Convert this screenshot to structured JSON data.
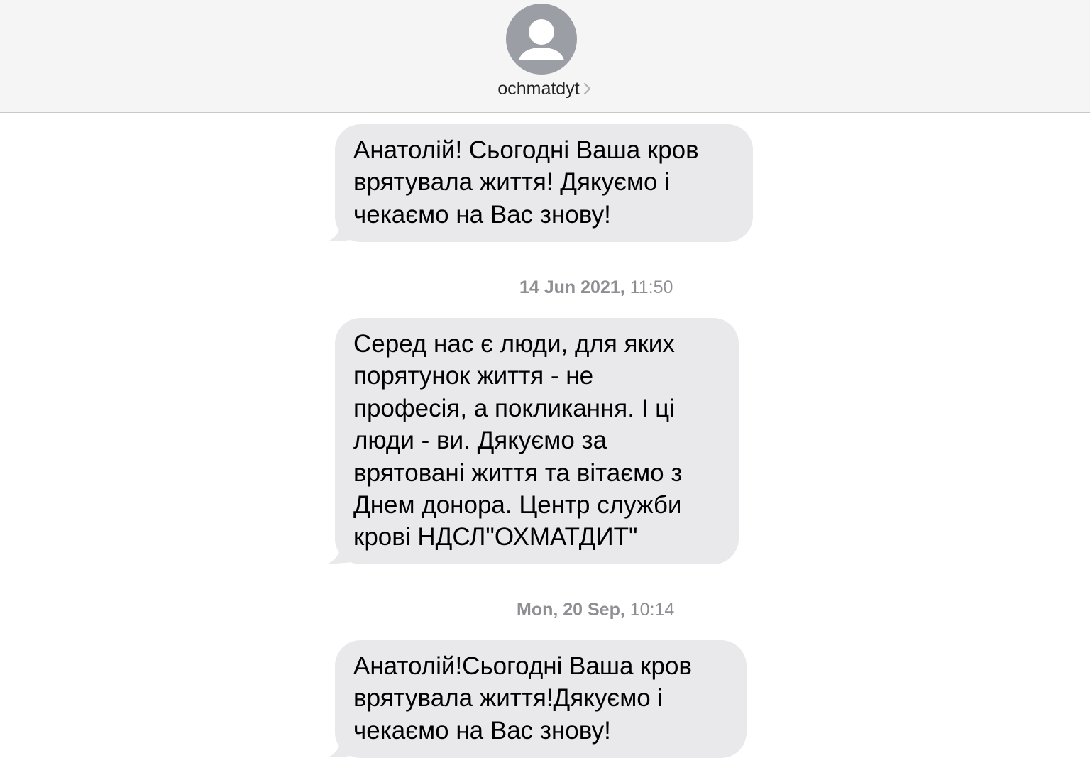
{
  "header": {
    "contact_name": "ochmatdyt",
    "avatar_icon": "person-silhouette-icon",
    "chevron_icon": "chevron-right-icon"
  },
  "colors": {
    "header_bg": "#f5f5f5",
    "incoming_bubble": "#e9e9eb",
    "avatar": "#9c9ea6",
    "timestamp_text": "#8e8e93"
  },
  "messages": [
    {
      "lines": [
        "Анатолій! Сьогодні Ваша кров",
        "врятувала життя! Дякуємо і",
        "чекаємо на Вас знову!"
      ]
    },
    {
      "timestamp_date": "14 Jun 2021,",
      "timestamp_time": " 11:50",
      "lines": [
        "Серед нас є люди, для яких",
        "порятунок життя - не",
        "професія, а покликання. І ці",
        "люди - ви. Дякуємо за",
        "врятовані життя та вітаємо з",
        "Днем донора. Центр служби",
        "крові НДСЛ\"ОХМАТДИТ\""
      ]
    },
    {
      "timestamp_date": "Mon, 20 Sep,",
      "timestamp_time": " 10:14",
      "lines": [
        "Анатолій!Сьогодні Ваша кров",
        "врятувала життя!Дякуємо і",
        "чекаємо на Вас знову!"
      ]
    }
  ]
}
